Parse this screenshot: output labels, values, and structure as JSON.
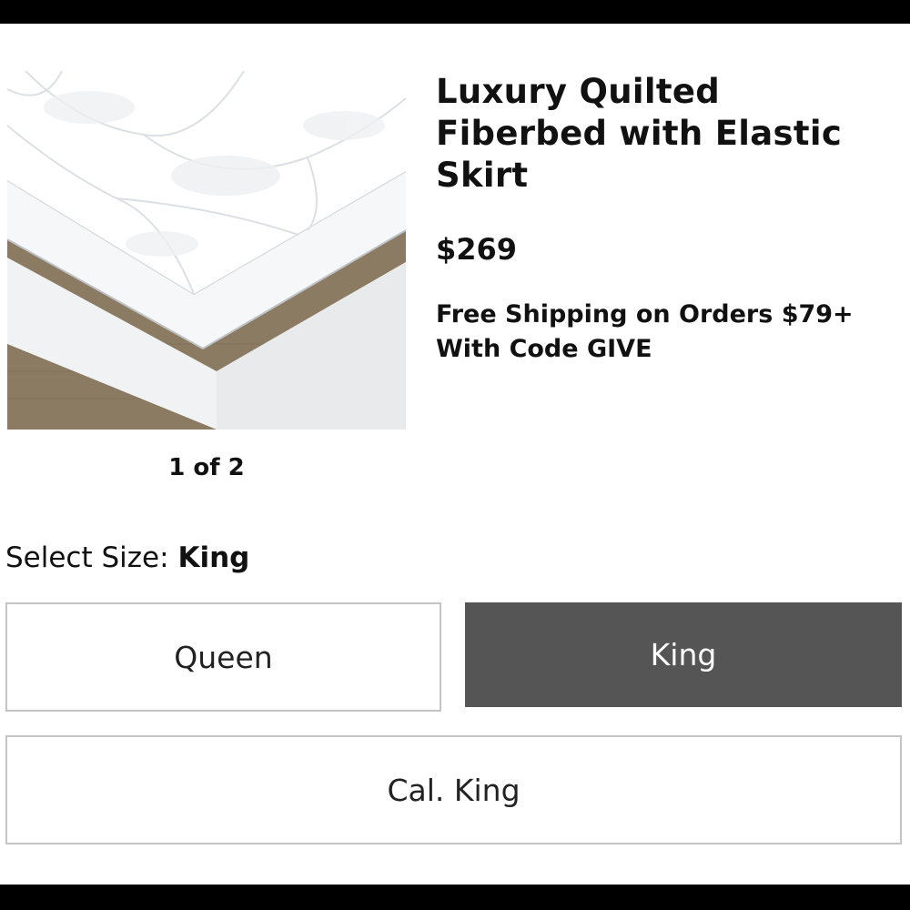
{
  "product": {
    "title": "Luxury Quilted Fiberbed with Elastic Skirt",
    "price": "$269",
    "shipping_note": "Free Shipping on Orders $79+ With Code GIVE",
    "image_alt": "White quilted fiberbed on mattress",
    "carousel_counter": "1 of 2"
  },
  "size_selector": {
    "label": "Select Size:",
    "selected": "King",
    "options": [
      "Queen",
      "King",
      "Cal. King"
    ]
  }
}
